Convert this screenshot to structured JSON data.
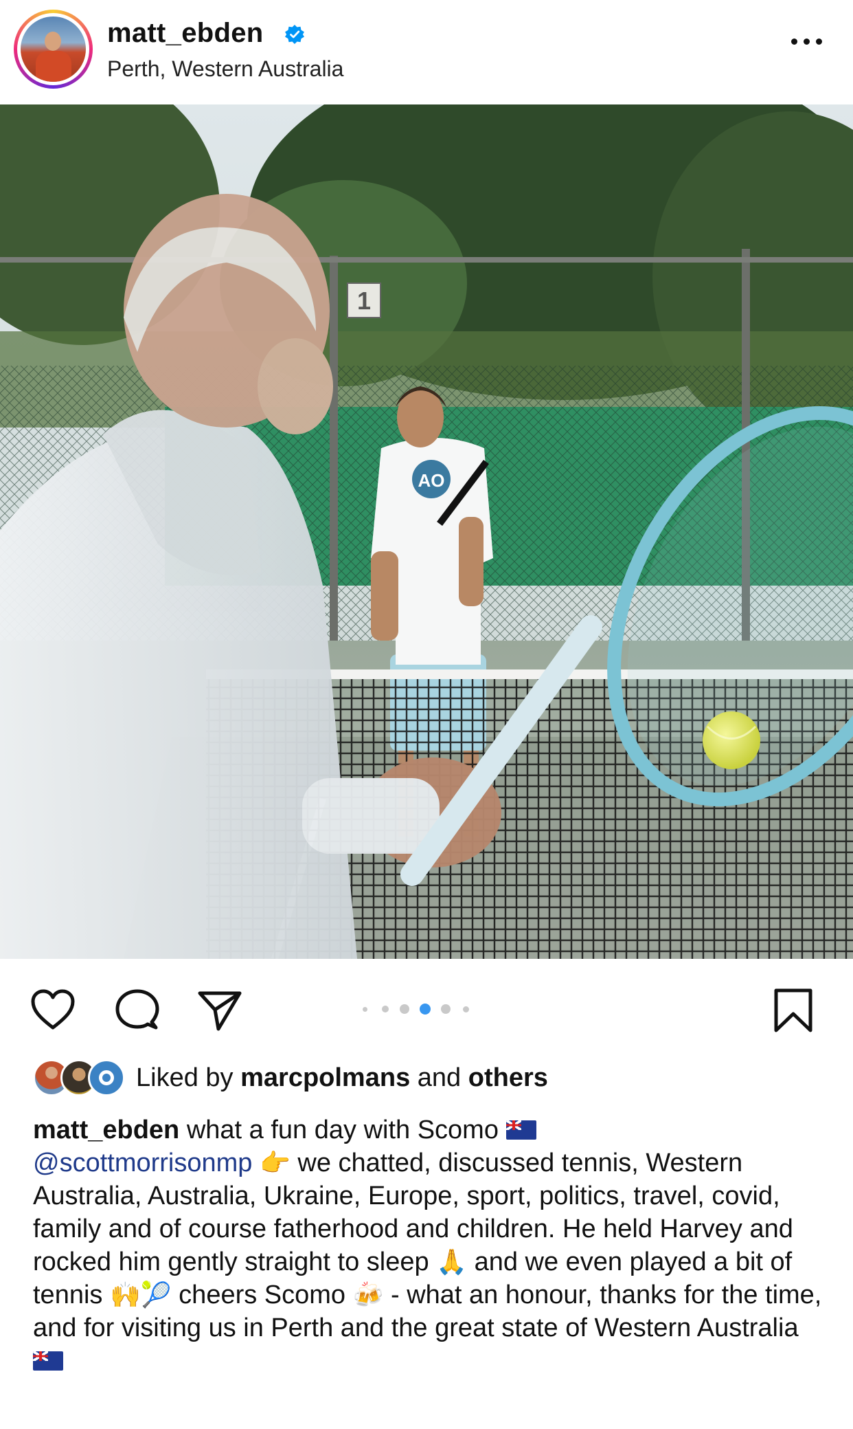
{
  "header": {
    "username": "matt_ebden",
    "verified": true,
    "location": "Perth, Western Australia",
    "more_icon": "more-horizontal-icon"
  },
  "photo": {
    "court_number": "1",
    "shirt_logo": "AO"
  },
  "actions": {
    "like_icon": "heart-icon",
    "comment_icon": "comment-icon",
    "share_icon": "send-icon",
    "save_icon": "bookmark-icon",
    "carousel": {
      "count": 5,
      "active_index": 3
    }
  },
  "likes": {
    "prefix": "Liked by",
    "first_user": "marcpolmans",
    "joiner": "and",
    "others": "others"
  },
  "caption": {
    "user": "matt_ebden",
    "part1": " what a fun day with Scomo ",
    "mention": "@scottmorrisonmp",
    "part2": " we chatted, discussed tennis, Western Australia, Australia, Ukraine, Europe, sport, politics, travel, covid, family and of course fatherhood and children. He held Harvey and rocked him gently straight to sleep ",
    "part3": " and we even played a bit of tennis ",
    "part4": " cheers Scomo ",
    "part5": " - what an honour, thanks for the time, and for visiting us in Perth and the great state of Western Australia",
    "emoji_point": "👉",
    "emoji_pray": "🙏",
    "emoji_hands": "🙌",
    "emoji_ball": "🎾",
    "emoji_beer": "🍻"
  },
  "colors": {
    "mention": "#1f3a8a",
    "carousel_active": "#3897f0"
  }
}
